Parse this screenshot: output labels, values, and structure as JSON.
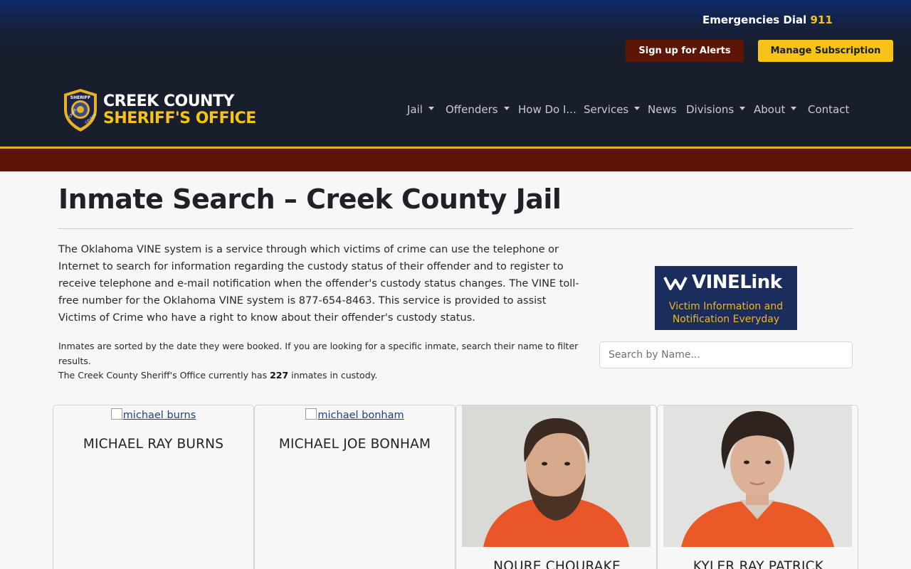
{
  "header": {
    "emergency_prefix": "Emergencies Dial",
    "emergency_number": "911",
    "alerts_button": "Sign up for Alerts",
    "manage_button": "Manage Subscription",
    "logo_line1": "CREEK COUNTY",
    "logo_line2": "SHERIFF'S OFFICE",
    "badge_text_top": "SHERIFF",
    "badge_text_left": "CREEK",
    "badge_text_right": "COUNTY"
  },
  "nav": [
    {
      "label": "Jail",
      "dropdown": true
    },
    {
      "label": "Offenders",
      "dropdown": true
    },
    {
      "label": "How Do I...",
      "dropdown": false
    },
    {
      "label": "Services",
      "dropdown": true
    },
    {
      "label": "News",
      "dropdown": false
    },
    {
      "label": "Divisions",
      "dropdown": true
    },
    {
      "label": "About",
      "dropdown": true
    },
    {
      "label": "Contact",
      "dropdown": false
    }
  ],
  "main": {
    "title": "Inmate Search – Creek County Jail",
    "intro": "The Oklahoma VINE system is a service through which victims of crime can use the telephone or Internet to search for information regarding the custody status of their offender and to register to receive telephone and e-mail notification when the offender's custody status changes. The VINE toll-free number for the Oklahoma VINE system is 877-654-8463. This service is provided to assist Victims of Crime who have a right to know about their offender's custody status.",
    "sort_note": "Inmates are sorted by the date they were booked. If you are looking for a specific inmate, search their name to filter results.",
    "count_prefix": "The Creek County Sheriff's Office currently has",
    "count_value": "227",
    "count_suffix": "inmates in custody.",
    "search_placeholder": "Search by Name..."
  },
  "vine_banner": {
    "brand": "VINELink",
    "line1": "Victim Information and",
    "line2": "Notification Everyday"
  },
  "inmates": [
    {
      "name": "MICHAEL RAY BURNS",
      "image_alt": "michael burns",
      "photo_loaded": false
    },
    {
      "name": "MICHAEL JOE BONHAM",
      "image_alt": "michael bonham",
      "photo_loaded": false
    },
    {
      "name": "NOURE CHOURAKE",
      "image_alt": "",
      "photo_loaded": true
    },
    {
      "name": "KYLER RAY PATRICK",
      "image_alt": "",
      "photo_loaded": true
    }
  ],
  "colors": {
    "header_bg": "#181e2c",
    "accent_gold": "#f7c316",
    "maroon": "#5c1507",
    "vine_navy": "#1b2d5c"
  }
}
